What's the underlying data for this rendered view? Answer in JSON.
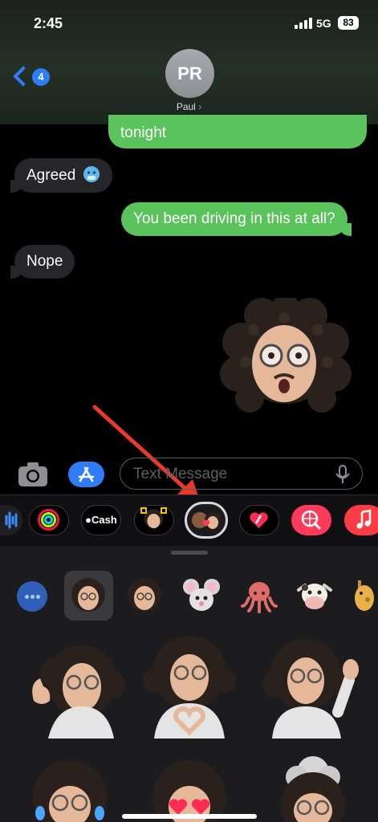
{
  "status": {
    "time": "2:45",
    "network": "5G",
    "battery": "83"
  },
  "header": {
    "back_badge": "4",
    "avatar_initials": "PR",
    "contact_name": "Paul",
    "contact_chevron": "›"
  },
  "messages": [
    {
      "from": "me",
      "text": "tonight"
    },
    {
      "from": "them",
      "text": "Agreed",
      "emoji": "cold-face"
    },
    {
      "from": "me",
      "text": "You been driving in this at all?"
    },
    {
      "from": "them",
      "text": "Nope"
    },
    {
      "from": "me",
      "type": "memoji-sticker",
      "description": "curly-hair-glasses-shocked"
    }
  ],
  "composer": {
    "placeholder": "Text Message"
  },
  "app_strip": [
    {
      "name": "soundwave"
    },
    {
      "name": "activity"
    },
    {
      "name": "apple-cash",
      "label": "Cash"
    },
    {
      "name": "memoji-app"
    },
    {
      "name": "memoji-stickers",
      "selected": true
    },
    {
      "name": "digital-touch"
    },
    {
      "name": "images-search"
    },
    {
      "name": "music"
    }
  ],
  "colors": {
    "accent": "#2f7df6",
    "bubble_out": "#5ac35b",
    "bubble_in": "#262628",
    "arrow": "#e8392b"
  }
}
